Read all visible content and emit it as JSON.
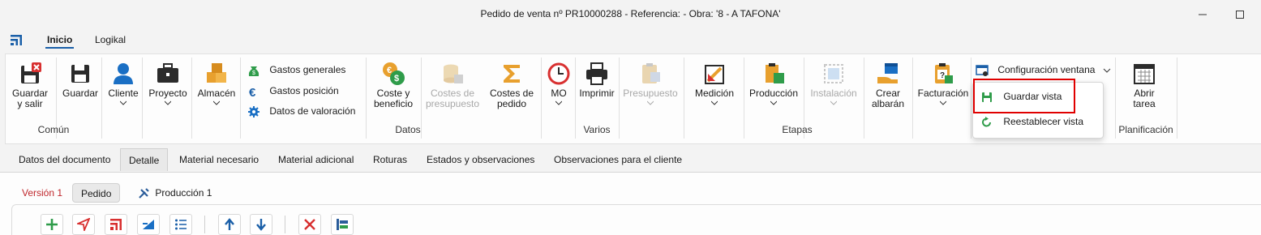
{
  "window": {
    "title": "Pedido de venta nº PR10000288 - Referencia:  - Obra: '8 - A TAFONA'"
  },
  "menu": {
    "tabs": [
      {
        "label": "Inicio"
      },
      {
        "label": "Logikal"
      }
    ]
  },
  "ribbon": {
    "comun": {
      "guardar_salir": "Guardar\ny salir",
      "guardar": "Guardar",
      "group": "Común"
    },
    "cliente": "Cliente",
    "proyecto": "Proyecto",
    "almacen": "Almacén",
    "datos": {
      "gastos_generales": "Gastos generales",
      "gastos_posicion": "Gastos posición",
      "datos_valoracion": "Datos de valoración",
      "coste_beneficio": "Coste y\nbeneficio",
      "costes_presupuesto": "Costes de\npresupuesto",
      "costes_pedido": "Costes de\npedido",
      "mo": "MO",
      "group": "Datos"
    },
    "varios": {
      "imprimir": "Imprimir",
      "group": "Varios"
    },
    "etapas": {
      "presupuesto": "Presupuesto",
      "medicion": "Medición",
      "produccion": "Producción",
      "instalacion": "Instalación",
      "crear_albaran": "Crear\nalbarán",
      "facturacion": "Facturación",
      "group": "Etapas"
    },
    "config": {
      "label": "Configuración ventana"
    },
    "planificacion": {
      "abrir_tarea": "Abrir\ntarea",
      "group": "Planificación"
    }
  },
  "dropdown": {
    "guardar_vista": "Guardar vista",
    "reestablecer_vista": "Reestablecer vista"
  },
  "doc_tabs": [
    {
      "label": "Datos del documento"
    },
    {
      "label": "Detalle"
    },
    {
      "label": "Material necesario"
    },
    {
      "label": "Material adicional"
    },
    {
      "label": "Roturas"
    },
    {
      "label": "Estados y observaciones"
    },
    {
      "label": "Observaciones para el cliente"
    }
  ],
  "version_bar": {
    "version": "Versión 1",
    "pedido": "Pedido",
    "produccion": "Producción 1"
  },
  "colors": {
    "accent": "#1a5fa8",
    "danger": "#d83030",
    "highlight_box": "#e00000",
    "green": "#2f9c4a",
    "orange": "#e8a02e"
  }
}
